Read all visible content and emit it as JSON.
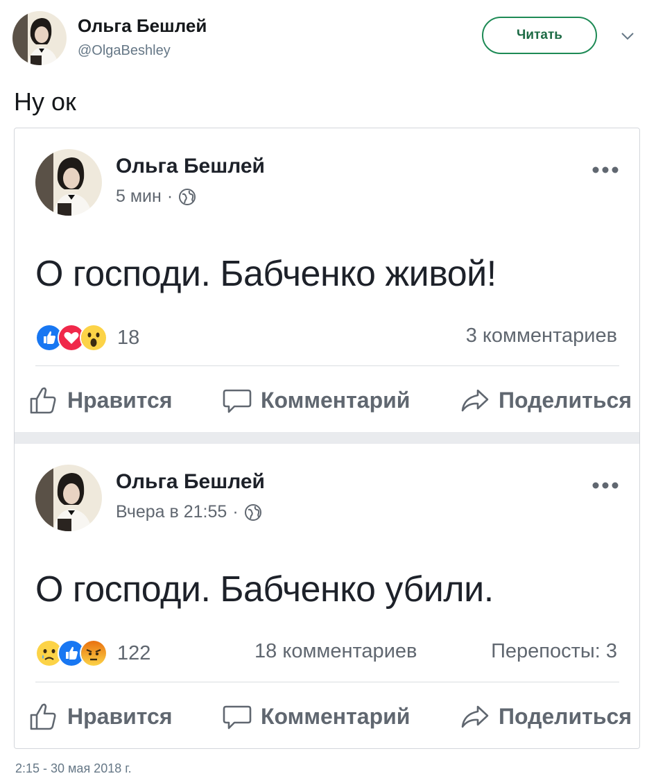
{
  "tweet": {
    "author_name": "Ольга Бешлей",
    "author_handle": "@OlgaBeshley",
    "follow_label": "Читать",
    "text": "Ну ок",
    "date_partial": "2:15 - 30 мая 2018 г."
  },
  "posts": [
    {
      "author": "Ольга Бешлей",
      "time": "5 мин",
      "separator": "·",
      "body": "О господи. Бабченко живой!",
      "reactions": [
        "like-icon",
        "love-icon",
        "wow-icon"
      ],
      "reaction_count": "18",
      "comments": "3 комментариев",
      "shares": ""
    },
    {
      "author": "Ольга Бешлей",
      "time": "Вчера в 21:55",
      "separator": "·",
      "body": "О господи. Бабченко убили.",
      "reactions": [
        "sad-icon",
        "like-icon",
        "angry-icon"
      ],
      "reaction_count": "122",
      "comments": "18 комментариев",
      "shares": "Перепосты: 3"
    }
  ],
  "actions": {
    "like": "Нравится",
    "comment": "Комментарий",
    "share": "Поделиться"
  },
  "colors": {
    "follow_border": "#1d8a55",
    "like_blue": "#1877f2",
    "love_red": "#f0284a",
    "reaction_yellow": "#fcd347",
    "angry_orange": "#e9710f"
  }
}
